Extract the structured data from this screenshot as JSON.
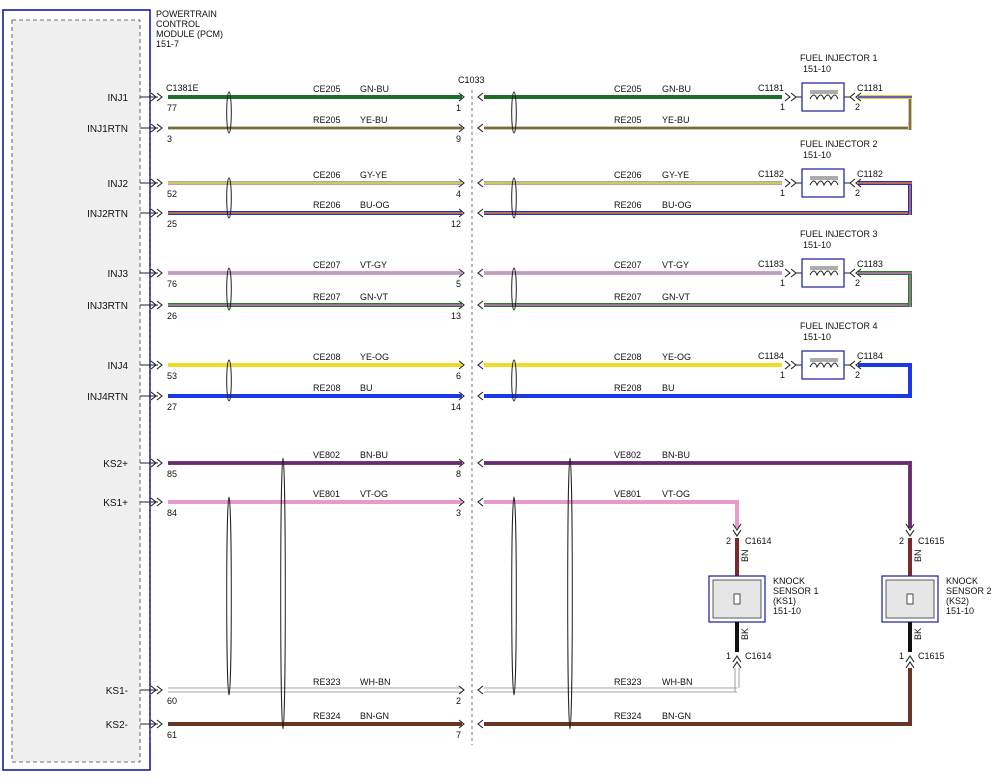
{
  "module": {
    "title_lines": [
      "POWERTRAIN",
      "CONTROL",
      "MODULE (PCM)",
      "151-7"
    ],
    "connector": "C1381E"
  },
  "inline_connector": "C1033",
  "pins": [
    {
      "label": "INJ1",
      "pcm_pin": "77",
      "c1033_pin": "1",
      "left_circuit": "CE205",
      "left_color": "GN-BU",
      "right_circuit": "CE205",
      "right_color": "GN-BU",
      "wire_colors": [
        "#1e6e2a",
        "#1e6e2a"
      ]
    },
    {
      "label": "INJ1RTN",
      "pcm_pin": "3",
      "c1033_pin": "9",
      "left_circuit": "RE205",
      "left_color": "YE-BU",
      "right_circuit": "RE205",
      "right_color": "YE-BU",
      "wire_colors": [
        "#e6cf3a",
        "#3a3ad8"
      ]
    },
    {
      "label": "INJ2",
      "pcm_pin": "52",
      "c1033_pin": "4",
      "left_circuit": "CE206",
      "left_color": "GY-YE",
      "right_circuit": "CE206",
      "right_color": "GY-YE",
      "wire_colors": [
        "#a8a8a8",
        "#e6cf3a"
      ]
    },
    {
      "label": "INJ2RTN",
      "pcm_pin": "25",
      "c1033_pin": "12",
      "left_circuit": "RE206",
      "left_color": "BU-OG",
      "right_circuit": "RE206",
      "right_color": "BU-OG",
      "wire_colors": [
        "#2b2bd0",
        "#e08a20"
      ]
    },
    {
      "label": "INJ3",
      "pcm_pin": "76",
      "c1033_pin": "5",
      "left_circuit": "CE207",
      "left_color": "VT-GY",
      "right_circuit": "CE207",
      "right_color": "VT-GY",
      "wire_colors": [
        "#d79ad6",
        "#a8a8a8"
      ]
    },
    {
      "label": "INJ3RTN",
      "pcm_pin": "26",
      "c1033_pin": "13",
      "left_circuit": "RE207",
      "left_color": "GN-VT",
      "right_circuit": "RE207",
      "right_color": "GN-VT",
      "wire_colors": [
        "#2f7d2a",
        "#c070c0"
      ]
    },
    {
      "label": "INJ4",
      "pcm_pin": "53",
      "c1033_pin": "6",
      "left_circuit": "CE208",
      "left_color": "YE-OG",
      "right_circuit": "CE208",
      "right_color": "YE-OG",
      "wire_colors": [
        "#f2dc2a",
        "#f2dc2a"
      ]
    },
    {
      "label": "INJ4RTN",
      "pcm_pin": "27",
      "c1033_pin": "14",
      "left_circuit": "RE208",
      "left_color": "BU",
      "right_circuit": "RE208",
      "right_color": "BU",
      "wire_colors": [
        "#1a3ae8",
        "#1a3ae8"
      ]
    },
    {
      "label": "KS2+",
      "pcm_pin": "85",
      "c1033_pin": "8",
      "left_circuit": "VE802",
      "left_color": "BN-BU",
      "right_circuit": "VE802",
      "right_color": "BN-BU",
      "wire_colors": [
        "#7a3a7a",
        "#5a2a6a"
      ]
    },
    {
      "label": "KS1+",
      "pcm_pin": "84",
      "c1033_pin": "3",
      "left_circuit": "VE801",
      "left_color": "VT-OG",
      "right_circuit": "VE801",
      "right_color": "VT-OG",
      "wire_colors": [
        "#e79acb",
        "#e79acb"
      ]
    },
    {
      "label": "KS1-",
      "pcm_pin": "60",
      "c1033_pin": "2",
      "left_circuit": "RE323",
      "left_color": "WH-BN",
      "right_circuit": "RE323",
      "right_color": "WH-BN",
      "wire_colors": [
        "#d8d8d8",
        "#d8d8d8"
      ]
    },
    {
      "label": "KS2-",
      "pcm_pin": "61",
      "c1033_pin": "7",
      "left_circuit": "RE324",
      "left_color": "BN-GN",
      "right_circuit": "RE324",
      "right_color": "BN-GN",
      "wire_colors": [
        "#6b3524",
        "#6b3524"
      ]
    }
  ],
  "injectors": [
    {
      "title": "FUEL INJECTOR 1",
      "ref": "151-10",
      "conn_in": "C1181",
      "conn_out": "C1181",
      "pin_in": "1",
      "pin_out": "2"
    },
    {
      "title": "FUEL INJECTOR 2",
      "ref": "151-10",
      "conn_in": "C1182",
      "conn_out": "C1182",
      "pin_in": "1",
      "pin_out": "2"
    },
    {
      "title": "FUEL INJECTOR 3",
      "ref": "151-10",
      "conn_in": "C1183",
      "conn_out": "C1183",
      "pin_in": "1",
      "pin_out": "2"
    },
    {
      "title": "FUEL INJECTOR 4",
      "ref": "151-10",
      "conn_in": "C1184",
      "conn_out": "C1184",
      "pin_in": "1",
      "pin_out": "2"
    }
  ],
  "knock_sensors": [
    {
      "title_lines": [
        "KNOCK",
        "SENSOR 1",
        "(KS1)",
        "151-10"
      ],
      "connector": "C1614",
      "pin_top": "2",
      "pin_bottom": "1",
      "wire_top": "BN",
      "wire_bottom": "BK"
    },
    {
      "title_lines": [
        "KNOCK",
        "SENSOR 2",
        "(KS2)",
        "151-10"
      ],
      "connector": "C1615",
      "pin_top": "2",
      "pin_bottom": "1",
      "wire_top": "BN",
      "wire_bottom": "BK"
    }
  ]
}
